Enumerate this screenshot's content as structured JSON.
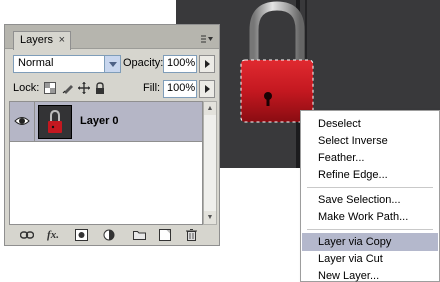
{
  "panel": {
    "tab_label": "Layers",
    "close_glyph": "×",
    "blend_mode": "Normal",
    "opacity_label": "Opacity:",
    "opacity_value": "100%",
    "lock_label": "Lock:",
    "fill_label": "Fill:",
    "fill_value": "100%",
    "layer_name": "Layer 0",
    "footer_icons": [
      "link-layers-icon",
      "fx-icon",
      "layer-mask-icon",
      "adjustment-layer-icon",
      "group-folder-icon",
      "new-layer-icon",
      "trash-icon"
    ]
  },
  "context_menu": {
    "items": [
      "Deselect",
      "Select Inverse",
      "Feather...",
      "Refine Edge...",
      "Save Selection...",
      "Make Work Path...",
      "Layer via Copy",
      "Layer via Cut",
      "New Layer..."
    ],
    "highlighted": "Layer via Copy"
  },
  "colors": {
    "lock_red": "#c41820",
    "selection_highlight": "#b4b8cc",
    "layer_selected": "#b5b6c6"
  }
}
